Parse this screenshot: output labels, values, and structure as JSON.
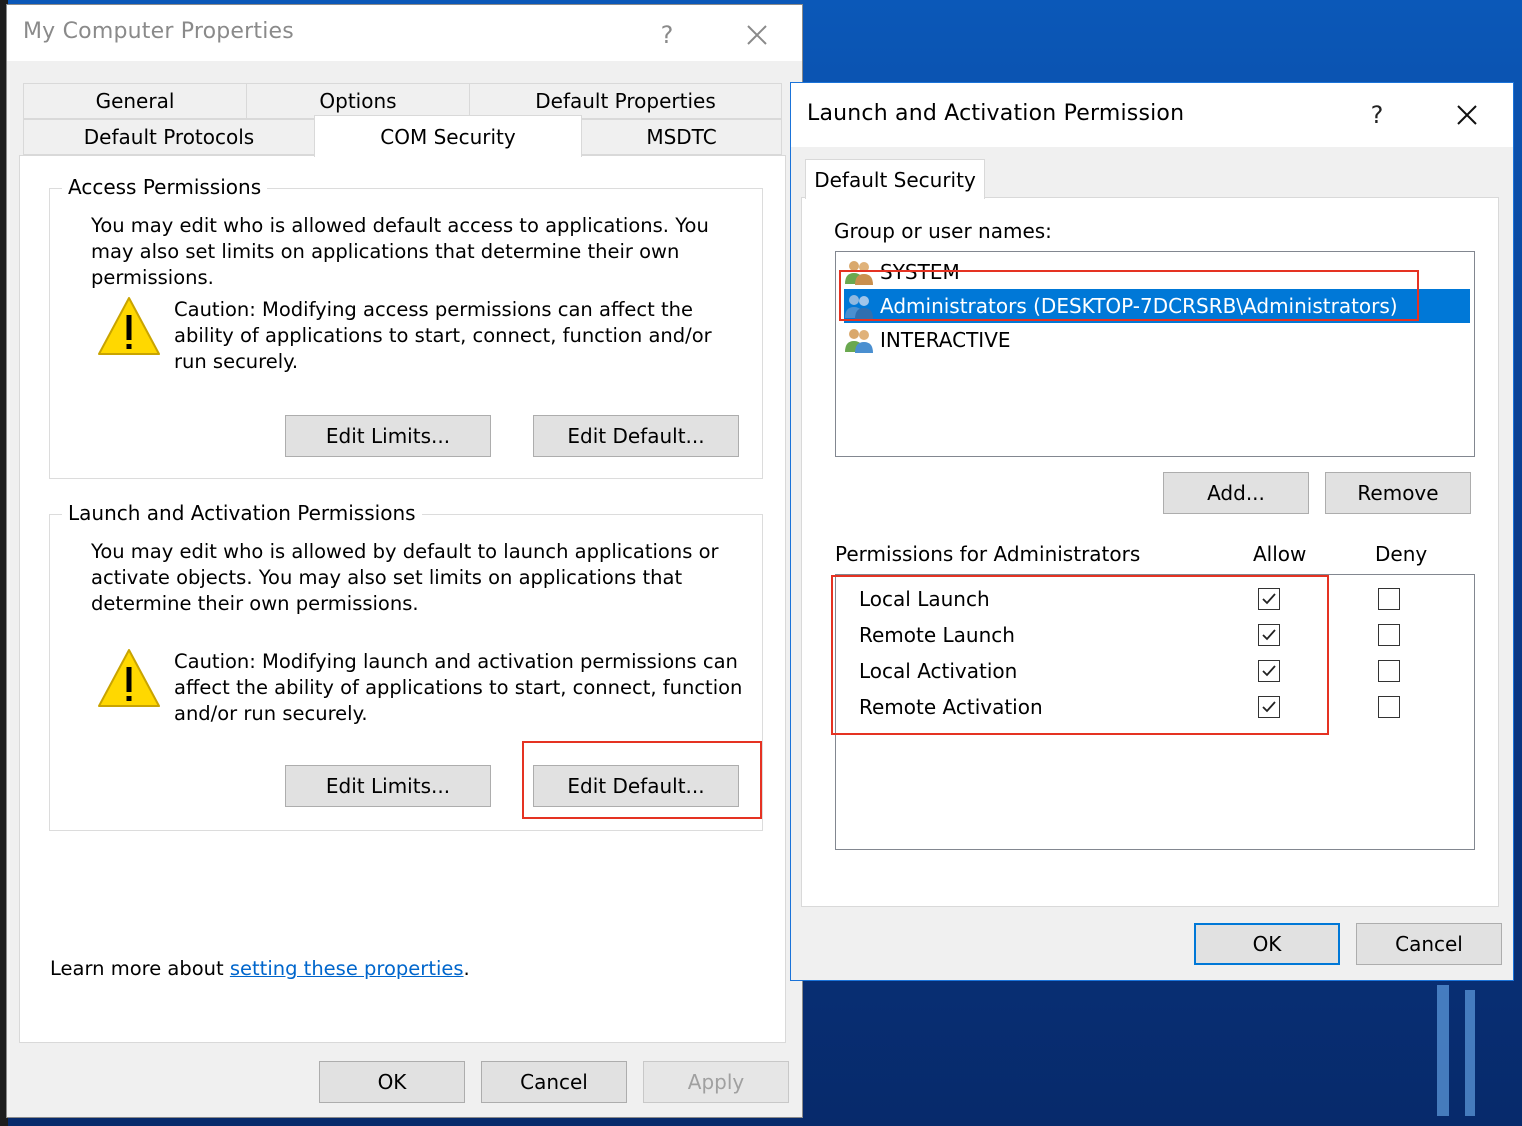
{
  "main_window": {
    "title": "My Computer Properties",
    "help": "?",
    "close": "✕",
    "tabs_row1": [
      "General",
      "Options",
      "Default Properties"
    ],
    "tabs_row2": [
      "Default Protocols",
      "COM Security",
      "MSDTC"
    ],
    "access": {
      "title": "Access Permissions",
      "description": "You may edit who is allowed default access to applications. You may also set limits on applications that determine their own permissions.",
      "caution": "Caution: Modifying access permissions can affect the ability of applications to start, connect, function and/or run securely.",
      "edit_limits": "Edit Limits...",
      "edit_default": "Edit Default..."
    },
    "launch": {
      "title": "Launch and Activation Permissions",
      "description": "You may edit who is allowed by default to launch applications or activate objects. You may also set limits on applications that determine their own permissions.",
      "caution": "Caution: Modifying launch and activation permissions can affect the ability of applications to start, connect, function and/or run securely.",
      "edit_limits": "Edit Limits...",
      "edit_default": "Edit Default..."
    },
    "learn_more_prefix": "Learn more about ",
    "learn_more_link": "setting these properties",
    "learn_more_suffix": ".",
    "ok": "OK",
    "cancel": "Cancel",
    "apply": "Apply"
  },
  "dialog": {
    "title": "Launch and Activation Permission",
    "help": "?",
    "close": "✕",
    "tab": "Default Security",
    "group_label": "Group or user names:",
    "users": [
      {
        "name": "SYSTEM",
        "selected": false
      },
      {
        "name": "Administrators (DESKTOP-7DCRSRB\\Administrators)",
        "selected": true
      },
      {
        "name": "INTERACTIVE",
        "selected": false
      }
    ],
    "add": "Add...",
    "remove": "Remove",
    "permissions_label": "Permissions for Administrators",
    "allow_header": "Allow",
    "deny_header": "Deny",
    "permissions": [
      {
        "name": "Local Launch",
        "allow": true,
        "deny": false
      },
      {
        "name": "Remote Launch",
        "allow": true,
        "deny": false
      },
      {
        "name": "Local Activation",
        "allow": true,
        "deny": false
      },
      {
        "name": "Remote Activation",
        "allow": true,
        "deny": false
      }
    ],
    "ok": "OK",
    "cancel": "Cancel"
  },
  "colors": {
    "highlight_red": "#e53222",
    "selection_blue": "#0078d7",
    "link_blue": "#0066cc",
    "warning_yellow": "#ffd800"
  }
}
